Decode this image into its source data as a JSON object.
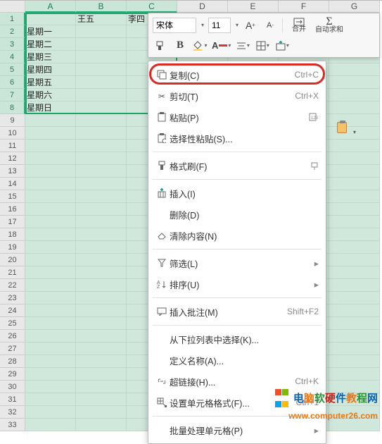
{
  "columns": [
    "A",
    "B",
    "C",
    "D",
    "E",
    "F",
    "G"
  ],
  "rows": [
    "1",
    "2",
    "3",
    "4",
    "5",
    "6",
    "7",
    "8",
    "9",
    "10",
    "11",
    "12",
    "13",
    "14",
    "15",
    "16",
    "17",
    "18",
    "19",
    "20",
    "21",
    "22",
    "23",
    "24",
    "25",
    "26",
    "27",
    "28",
    "29",
    "30",
    "31",
    "32",
    "33"
  ],
  "cells": {
    "B1": "王五",
    "C1": "李四",
    "A2": "星期一",
    "A3": "星期二",
    "A4": "星期三",
    "A5": "星期四",
    "A6": "星期五",
    "A7": "星期六",
    "A8": "星期日"
  },
  "minitoolbar": {
    "font": "宋体",
    "size": "11",
    "merge_label": "合并",
    "autosum_label": "自动求和"
  },
  "menu": {
    "copy": {
      "label": "复制(C)",
      "shortcut": "Ctrl+C"
    },
    "cut": {
      "label": "剪切(T)",
      "shortcut": "Ctrl+X"
    },
    "paste": {
      "label": "粘贴(P)"
    },
    "paste_special": {
      "label": "选择性粘贴(S)..."
    },
    "format_painter": {
      "label": "格式刷(F)"
    },
    "insert": {
      "label": "插入(I)"
    },
    "delete": {
      "label": "删除(D)"
    },
    "clear": {
      "label": "清除内容(N)"
    },
    "filter": {
      "label": "筛选(L)"
    },
    "sort": {
      "label": "排序(U)"
    },
    "insert_comment": {
      "label": "插入批注(M)",
      "shortcut": "Shift+F2"
    },
    "dropdown_list": {
      "label": "从下拉列表中选择(K)..."
    },
    "define_name": {
      "label": "定义名称(A)..."
    },
    "hyperlink": {
      "label": "超链接(H)...",
      "shortcut": "Ctrl+K"
    },
    "format_cells": {
      "label": "设置单元格格式(F)...",
      "shortcut": "Ctrl+1"
    },
    "batch_cells": {
      "label": "批量处理单元格(P)"
    }
  },
  "watermark": {
    "title_chars": [
      "电",
      "脑",
      "软",
      "硬",
      "件",
      "教",
      "程",
      "网"
    ],
    "url": "www.computer26.com"
  }
}
